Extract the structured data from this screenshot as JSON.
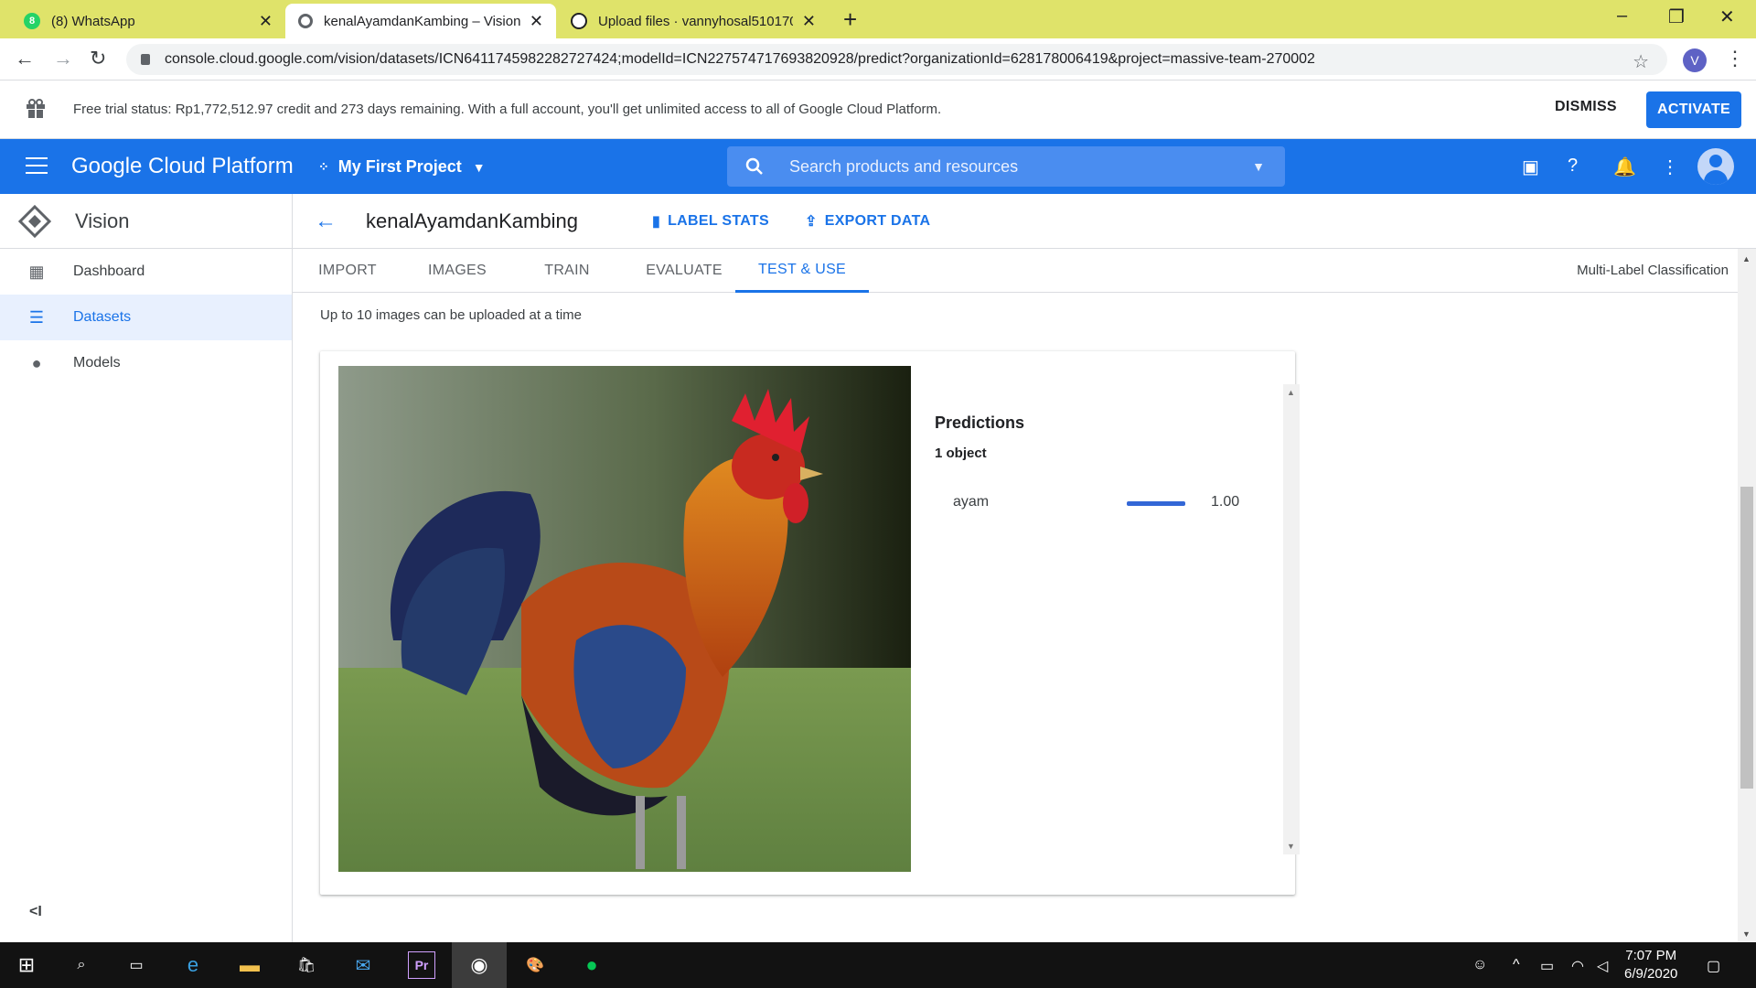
{
  "browser": {
    "tabs": [
      {
        "title": "(8) WhatsApp",
        "icon": "whatsapp-icon"
      },
      {
        "title": "kenalAyamdanKambing – Vision",
        "icon": "gcp-icon"
      },
      {
        "title": "Upload files · vannyhosal510170",
        "icon": "github-icon"
      }
    ],
    "url": "console.cloud.google.com/vision/datasets/ICN6411745982282727424;modelId=ICN227574717693820928/predict?organizationId=628178006419&project=massive-team-270002",
    "profile_initial": "V"
  },
  "trial_banner": {
    "message": "Free trial status: Rp1,772,512.97 credit and 273 days remaining. With a full account, you'll get unlimited access to all of Google Cloud Platform.",
    "dismiss_label": "DISMISS",
    "activate_label": "ACTIVATE"
  },
  "header": {
    "title": "Google Cloud Platform",
    "project": "My First Project",
    "search_placeholder": "Search products and resources"
  },
  "sidebar": {
    "title": "Vision",
    "items": [
      {
        "label": "Dashboard",
        "icon": "dashboard-icon"
      },
      {
        "label": "Datasets",
        "icon": "list-icon",
        "active": true
      },
      {
        "label": "Models",
        "icon": "lightbulb-icon"
      }
    ],
    "collapse_label": "<I"
  },
  "dataset": {
    "name": "kenalAyamdanKambing",
    "actions": {
      "label_stats": "LABEL STATS",
      "export_data": "EXPORT DATA"
    },
    "tabs": [
      "IMPORT",
      "IMAGES",
      "TRAIN",
      "EVALUATE",
      "TEST & USE"
    ],
    "active_tab": "TEST & USE",
    "model_type": "Multi-Label Classification",
    "upload_hint": "Up to 10 images can be uploaded at a time"
  },
  "predictions": {
    "title": "Predictions",
    "count": "1 object",
    "items": [
      {
        "label": "ayam",
        "score": "1.00",
        "score_value": 1.0
      }
    ]
  },
  "taskbar": {
    "time": "7:07 PM",
    "date": "6/9/2020"
  },
  "colors": {
    "accent": "#1a73e8",
    "tabbar": "#dfe36a"
  }
}
